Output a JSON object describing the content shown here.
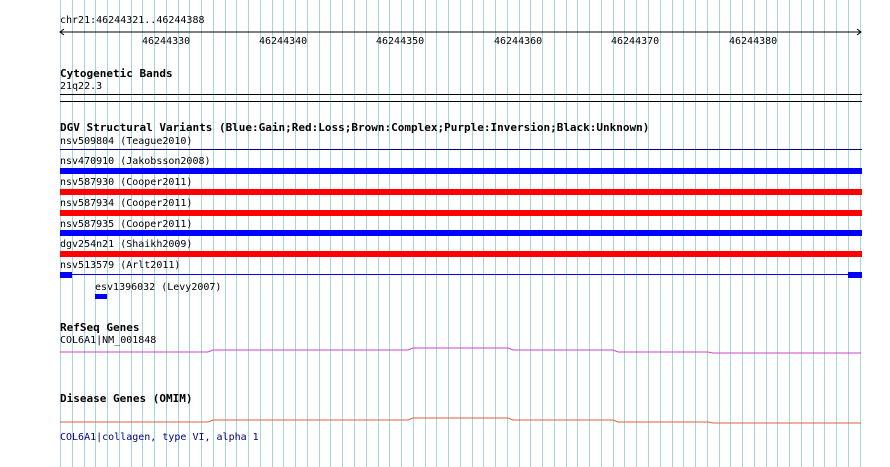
{
  "colors": {
    "grid": "#a8d4e0",
    "gain": "#0000ff",
    "loss": "#ff0000",
    "inversion": "#800080",
    "refseq": "#cc44cc",
    "disease": "#e06040",
    "link": "#000080",
    "rule": "#000000"
  },
  "ruler": {
    "region": "chr21:46244321..46244388",
    "ticks": [
      "46244330",
      "46244340",
      "46244350",
      "46244360",
      "46244370",
      "46244380"
    ]
  },
  "cytoband": {
    "title": "Cytogenetic Bands",
    "band": "21q22.3"
  },
  "dgv": {
    "title": "DGV Structural Variants (Blue:Gain;Red:Loss;Brown:Complex;Purple:Inversion;Black:Unknown)",
    "variants": [
      {
        "label": "nsv509804 (Teague2010)",
        "type": "inversion"
      },
      {
        "label": "nsv470910 (Jakobsson2008)",
        "type": "gain"
      },
      {
        "label": "nsv587930 (Cooper2011)",
        "type": "loss"
      },
      {
        "label": "nsv587934 (Cooper2011)",
        "type": "loss"
      },
      {
        "label": "nsv587935 (Cooper2011)",
        "type": "gain"
      },
      {
        "label": "dgv254n21 (Shaikh2009)",
        "type": "loss"
      },
      {
        "label": "nsv513579 (Arlt2011)",
        "type": "gain"
      },
      {
        "label": "esv1396032 (Levy2007)",
        "type": "gain"
      }
    ]
  },
  "refseq": {
    "title": "RefSeq Genes",
    "gene": "COL6A1|NM_001848"
  },
  "disease": {
    "title": "Disease Genes (OMIM)",
    "gene": "COL6A1|collagen, type VI, alpha 1"
  }
}
